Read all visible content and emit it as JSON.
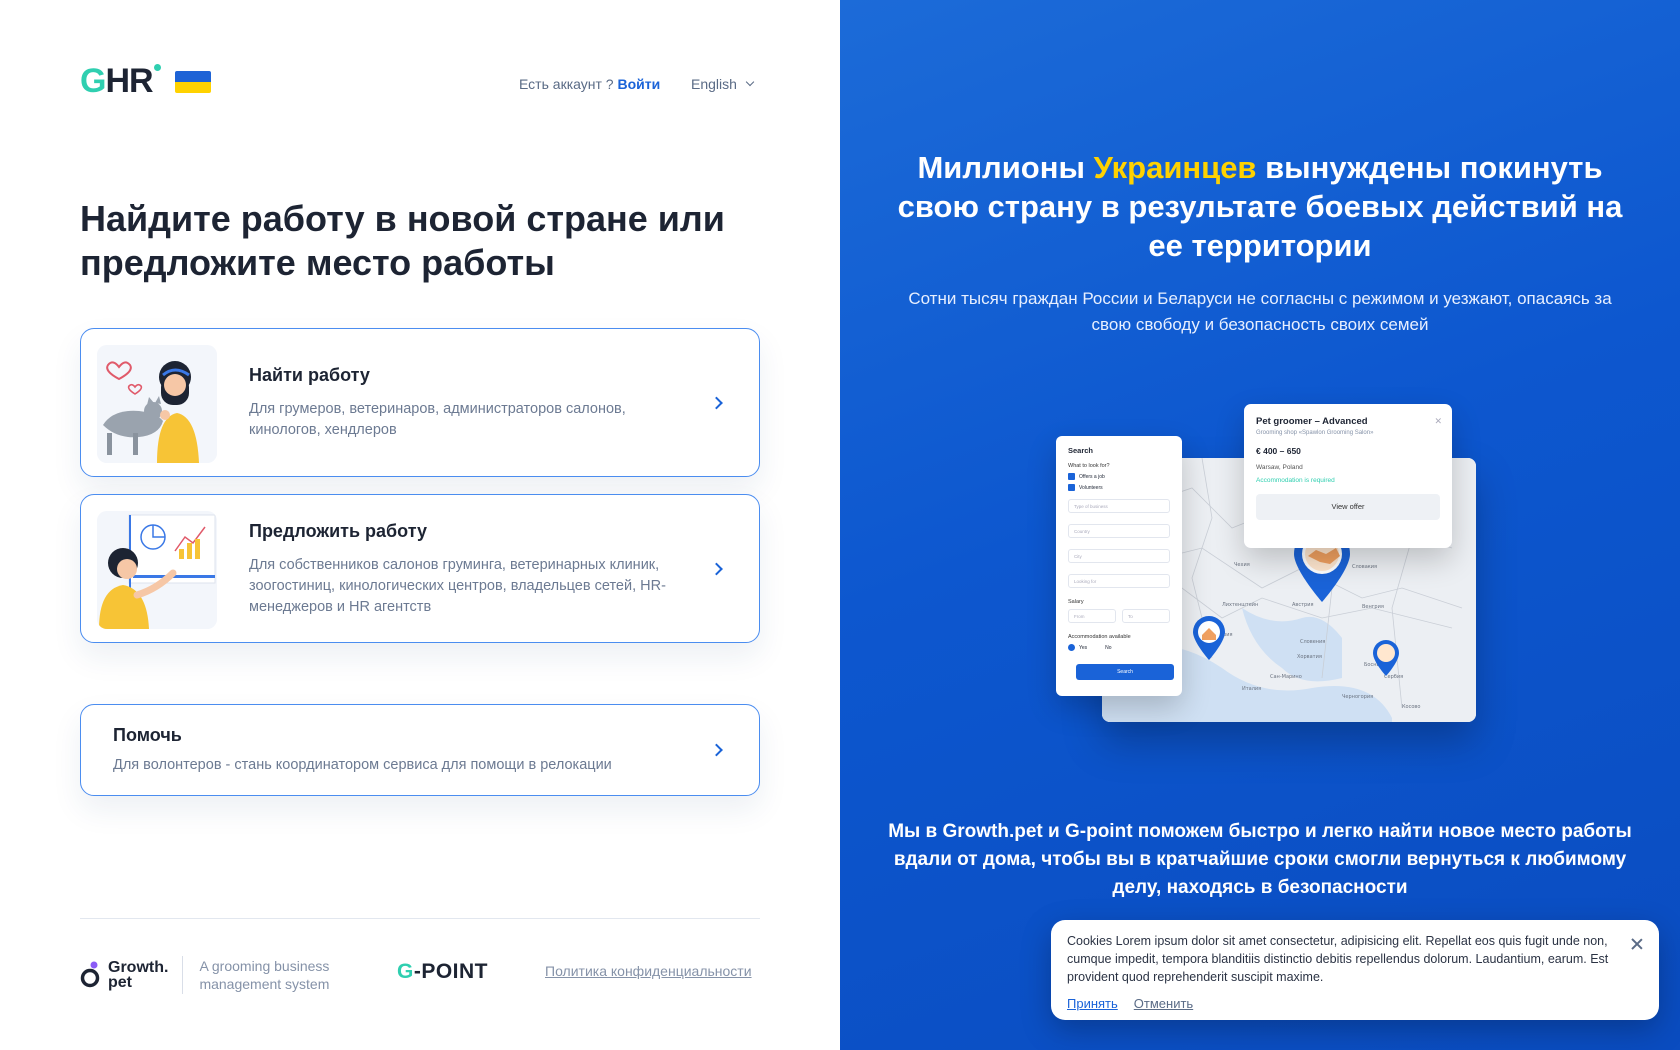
{
  "header": {
    "logo_g": "G",
    "logo_hr": "HR",
    "account_question": "Есть аккаунт ? ",
    "login_link": "Войти",
    "language": "English"
  },
  "hero": {
    "title": "Найдите работу в новой стране или предложите место работы"
  },
  "cards": [
    {
      "title": "Найти работу",
      "description": "Для грумеров, ветеринаров, администраторов салонов, кинологов, хендлеров"
    },
    {
      "title": "Предложить работу",
      "description": "Для собственников салонов груминга, ветеринарных клиник, зоогостиниц, кинологических центров, владельцев сетей, HR- менеджеров и HR агентств"
    },
    {
      "title": "Помочь",
      "description": "Для волонтеров - стань координатором сервиса для помощи в релокации"
    }
  ],
  "footer": {
    "growth_name_1": "Growth.",
    "growth_name_2": "pet",
    "growth_tagline": "A grooming business management system",
    "gpoint_g": "G",
    "gpoint_rest": "-POINT",
    "policy": "Политика конфиденциальности"
  },
  "right": {
    "title_before": "Миллионы ",
    "title_highlight": "Украинцев",
    "title_after": " вынуждены покинуть свою страну в результате боевых действий на ее территории",
    "subtitle": "Сотни тысяч граждан России и Беларуси не согласны с режимом и уезжают, опасаясь за свою свободу и безопасность своих семей",
    "bottom_text": "Мы в Growth.pet и G-point поможем быстро и легко найти новое место работы вдали от дома, чтобы вы в кратчайшие сроки смогли вернуться к любимому делу, находясь в безопасности",
    "highlight_color": "#ffd200"
  },
  "mockup": {
    "search_title": "Search",
    "what_to_look": "What to look for?",
    "cb1": "Offers a job",
    "cb2": "Volunteers",
    "f1": "Type of business",
    "f2": "Country",
    "f3": "City",
    "f4": "Looking for",
    "salary": "Salary",
    "from": "From",
    "to": "To",
    "accommodation": "Accommodation available",
    "yes": "Yes",
    "no": "No",
    "search_button": "Search",
    "offer_title": "Pet groomer – Advanced",
    "offer_shop": "Grooming shop «Spawlon Grooming Salon»",
    "offer_price": "€ 400 – 650",
    "offer_location": "Warsaw, Poland",
    "offer_accommodation": "Accommodation is required",
    "offer_button": "View offer"
  },
  "cookie": {
    "text": "Cookies Lorem ipsum dolor sit amet consectetur, adipisicing elit. Repellat eos quis fugit unde non, cumque impedit, tempora blanditiis distinctio debitis repellendus dolorum. Laudantium, earum. Est provident quod reprehenderit suscipit maxime.",
    "accept": "Принять",
    "cancel": "Отменить"
  },
  "colors": {
    "brand_blue": "#1a63d8",
    "brand_teal": "#2fcfb0",
    "card_border": "#4b8df0",
    "panel_blue": "#0d57cf"
  }
}
